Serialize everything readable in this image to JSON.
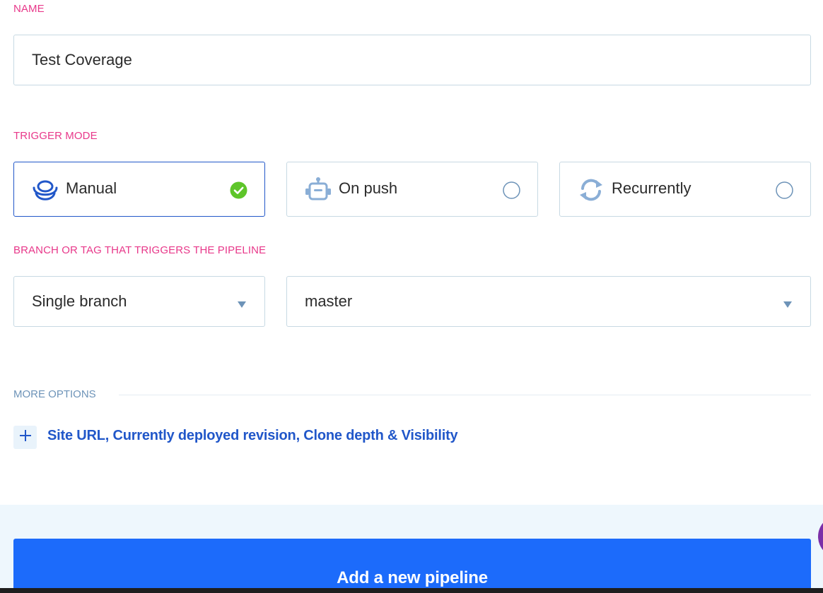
{
  "name_section": {
    "label": "NAME",
    "value": "Test Coverage"
  },
  "trigger_section": {
    "label": "TRIGGER MODE",
    "modes": [
      {
        "label": "Manual",
        "icon": "manual-hand-icon",
        "selected": true
      },
      {
        "label": "On push",
        "icon": "robot-icon",
        "selected": false
      },
      {
        "label": "Recurrently",
        "icon": "recurring-arrows-icon",
        "selected": false
      }
    ]
  },
  "branch_section": {
    "label": "BRANCH OR TAG THAT TRIGGERS THE PIPELINE",
    "type_value": "Single branch",
    "branch_value": "master"
  },
  "more_options": {
    "label": "MORE OPTIONS",
    "expand_text": "Site URL, Currently deployed revision, Clone depth & Visibility"
  },
  "footer": {
    "submit_label": "Add a new pipeline"
  },
  "colors": {
    "label_pink": "#e8388a",
    "primary_blue": "#1c6bfb",
    "link_blue": "#2157c9",
    "check_green": "#5ec52a",
    "border": "#c7d9e3"
  }
}
